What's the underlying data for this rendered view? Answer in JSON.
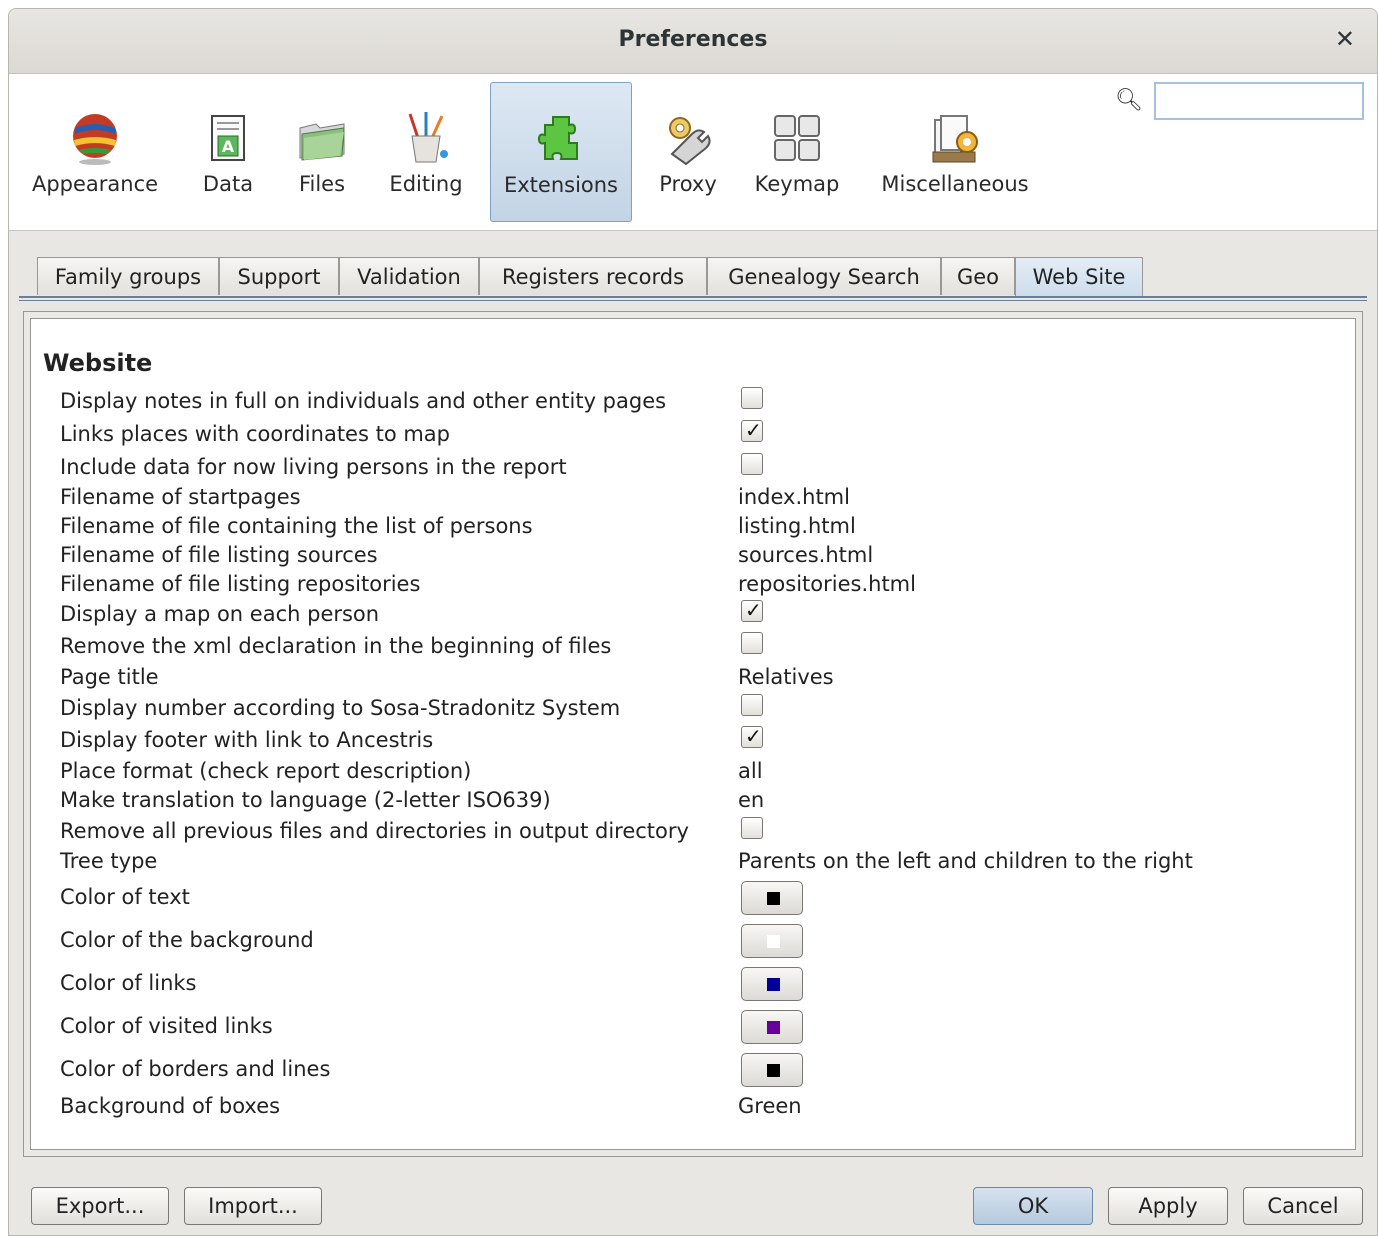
{
  "window": {
    "title": "Preferences"
  },
  "toolbar": {
    "items": [
      {
        "label": "Appearance",
        "icon": "globe-flags-icon"
      },
      {
        "label": "Data",
        "icon": "data-document-icon"
      },
      {
        "label": "Files",
        "icon": "folders-icon"
      },
      {
        "label": "Editing",
        "icon": "brush-cup-icon"
      },
      {
        "label": "Extensions",
        "icon": "puzzle-piece-icon"
      },
      {
        "label": "Proxy",
        "icon": "gear-wrench-icon"
      },
      {
        "label": "Keymap",
        "icon": "keyboard-icon"
      },
      {
        "label": "Miscellaneous",
        "icon": "misc-settings-icon"
      }
    ],
    "active": "Extensions",
    "search": {
      "value": "",
      "placeholder": ""
    }
  },
  "tabs": {
    "items": [
      "Family groups",
      "Support",
      "Validation",
      "Registers records",
      "Genealogy Search",
      "Geo",
      "Web Site"
    ],
    "active": "Web Site"
  },
  "website": {
    "title": "Website",
    "rows": [
      {
        "label": "Display notes in full on individuals and other entity pages",
        "type": "checkbox",
        "checked": false
      },
      {
        "label": "Links places with coordinates to map",
        "type": "checkbox",
        "checked": true
      },
      {
        "label": "Include data for now living persons in the report",
        "type": "checkbox",
        "checked": false
      },
      {
        "label": "Filename of startpages",
        "type": "text",
        "value": "index.html"
      },
      {
        "label": "Filename of file containing the list of persons",
        "type": "text",
        "value": "listing.html"
      },
      {
        "label": "Filename of file listing sources",
        "type": "text",
        "value": "sources.html"
      },
      {
        "label": "Filename of file listing repositories",
        "type": "text",
        "value": "repositories.html"
      },
      {
        "label": "Display a map on each person",
        "type": "checkbox",
        "checked": true
      },
      {
        "label": "Remove the xml declaration in the beginning of files",
        "type": "checkbox",
        "checked": false
      },
      {
        "label": "Page title",
        "type": "text",
        "value": "Relatives"
      },
      {
        "label": "Display number according to Sosa-Stradonitz System",
        "type": "checkbox",
        "checked": false
      },
      {
        "label": "Display footer with link to Ancestris",
        "type": "checkbox",
        "checked": true
      },
      {
        "label": "Place format (check report description)",
        "type": "text",
        "value": "all"
      },
      {
        "label": "Make translation to language (2-letter ISO639)",
        "type": "text",
        "value": "en"
      },
      {
        "label": "Remove all previous files and directories in output directory",
        "type": "checkbox",
        "checked": false
      },
      {
        "label": "Tree type",
        "type": "text",
        "value": "Parents on the left and children to the right"
      },
      {
        "label": "Color of text",
        "type": "color",
        "color": "#000000"
      },
      {
        "label": "Color of the background",
        "type": "color",
        "color": "#ffffff"
      },
      {
        "label": "Color of links",
        "type": "color",
        "color": "#000099"
      },
      {
        "label": "Color of visited links",
        "type": "color",
        "color": "#660099"
      },
      {
        "label": "Color of borders and lines",
        "type": "color",
        "color": "#000000"
      },
      {
        "label": "Background of boxes",
        "type": "text",
        "value": "Green"
      }
    ]
  },
  "buttons": {
    "export": "Export...",
    "import": "Import...",
    "ok": "OK",
    "apply": "Apply",
    "cancel": "Cancel"
  },
  "colors": {
    "accent": "#c3d4e6",
    "tab_line": "#6a7f95"
  }
}
